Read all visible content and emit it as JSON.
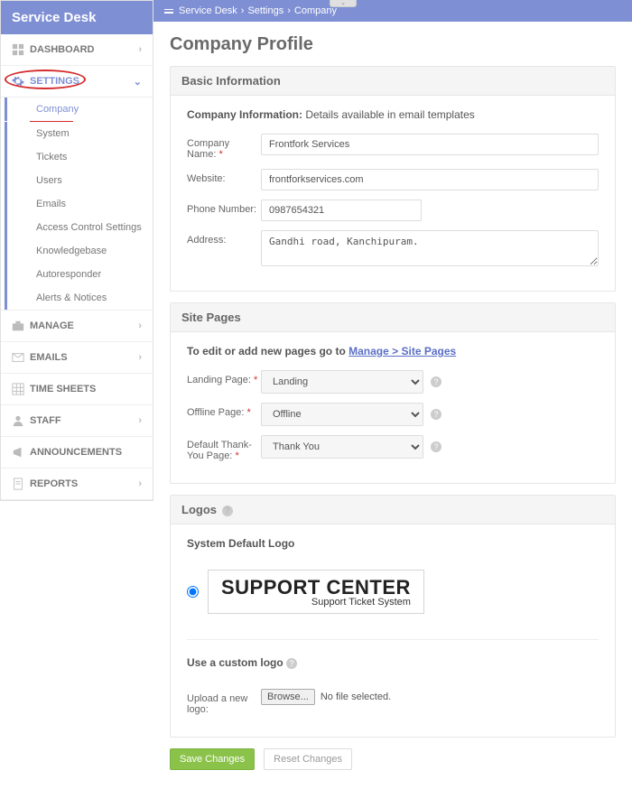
{
  "brand": "Service Desk",
  "breadcrumb": {
    "a": "Service Desk",
    "b": "Settings",
    "c": "Company"
  },
  "nav": {
    "dashboard": "DASHBOARD",
    "settings": "SETTINGS",
    "manage": "MANAGE",
    "emails": "EMAILS",
    "timesheets": "TIME SHEETS",
    "staff": "STAFF",
    "announcements": "ANNOUNCEMENTS",
    "reports": "REPORTS"
  },
  "subnav": {
    "company": "Company",
    "system": "System",
    "tickets": "Tickets",
    "users": "Users",
    "emails": "Emails",
    "acl": "Access Control Settings",
    "kb": "Knowledgebase",
    "autoresponder": "Autoresponder",
    "alerts": "Alerts & Notices"
  },
  "page_title": "Company Profile",
  "basic": {
    "head": "Basic Information",
    "intro_bold": "Company Information:",
    "intro_rest": " Details available in email templates",
    "company_label": "Company Name:",
    "company_value": "Frontfork Services",
    "website_label": "Website:",
    "website_value": "frontforkservices.com",
    "phone_label": "Phone Number:",
    "phone_value": "0987654321",
    "address_label": "Address:",
    "address_value": "Gandhi road, Kanchipuram."
  },
  "site": {
    "head": "Site Pages",
    "intro_a": "To edit or add new pages go to ",
    "intro_link": "Manage > Site Pages",
    "landing_label": "Landing Page:",
    "landing_value": "Landing",
    "offline_label": "Offline Page:",
    "offline_value": "Offline",
    "thank_label": "Default Thank-You Page:",
    "thank_value": "Thank You"
  },
  "logos": {
    "head": "Logos",
    "system_label": "System Default Logo",
    "logo_main": "SUPPORT CENTER",
    "logo_sub": "Support Ticket System",
    "custom_label": "Use a custom logo",
    "upload_label": "Upload a new logo:",
    "browse": "Browse...",
    "nofile": "No file selected."
  },
  "buttons": {
    "save": "Save Changes",
    "reset": "Reset Changes"
  }
}
